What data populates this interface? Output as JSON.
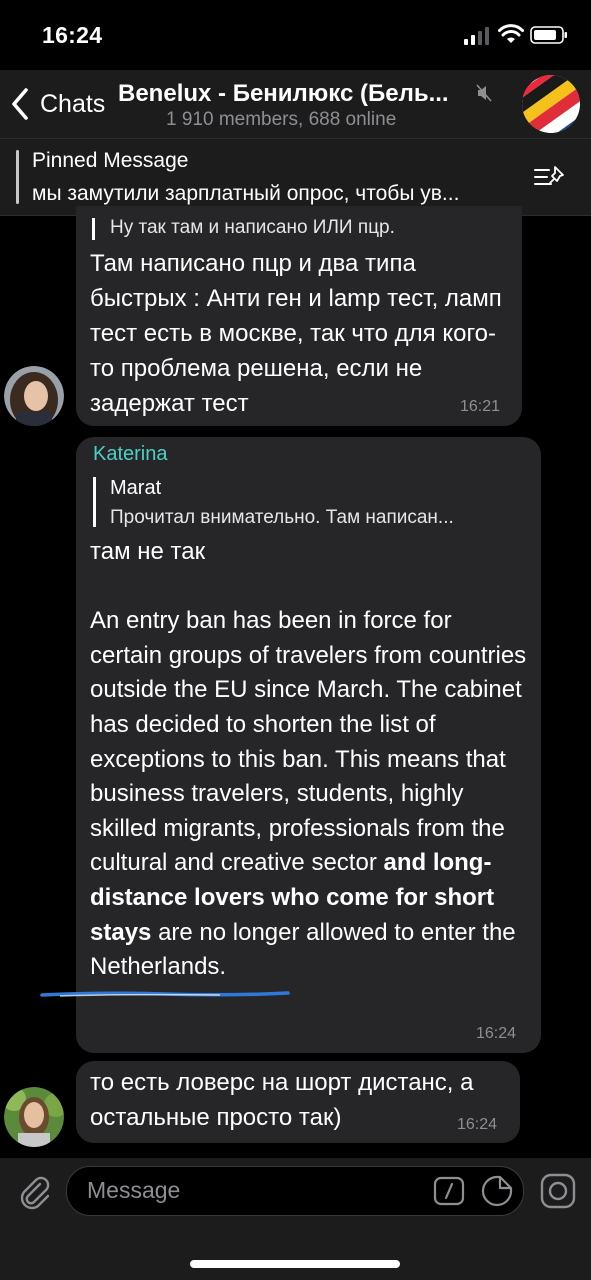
{
  "status_bar": {
    "time": "16:24"
  },
  "header": {
    "back_label": "Chats",
    "title": "Benelux - Бенилюкс (Бель...",
    "subtitle": "1 910 members, 688 online"
  },
  "pinned": {
    "title": "Pinned Message",
    "text": "мы замутили зарплатный опрос, чтобы ув..."
  },
  "messages": [
    {
      "reply_text": "Ну так там и написано ИЛИ пцр.",
      "text": "Там написано пцр и два типа быстрых : Анти ген и lamp тест, ламп тест есть в москве, так что для кого-то проблема решена, если не задержат тест",
      "time": "16:21"
    },
    {
      "sender": "Katerina",
      "reply_name": "Marat",
      "reply_text": "Прочитал внимательно. Там написан...",
      "text_intro": "там не так",
      "text_main": "An entry ban has been in force for certain groups of travelers from countries outside the EU since March. The cabinet has decided to shorten the list of exceptions to this ban. This means that business travelers, students, highly skilled migrants, professionals from the cultural and creative sector",
      "text_bold": "and long-distance lovers who come for short stays",
      "text_end": "are no longer allowed to enter the Netherlands.",
      "time": "16:24"
    },
    {
      "text": "то есть ловерс на шорт дистанс, а остальные просто так)",
      "time": "16:24"
    }
  ],
  "input": {
    "placeholder": "Message"
  },
  "colors": {
    "sender_name": "#4cd0c4",
    "bubble": "#262628",
    "background": "#000000"
  }
}
